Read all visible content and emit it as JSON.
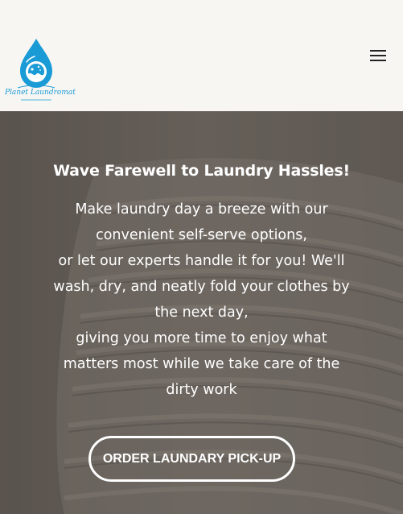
{
  "header": {
    "logo_text": "Planet Laundromat",
    "menu_icon": "hamburger-menu-icon"
  },
  "hero": {
    "title": "Wave Farewell to Laundry Hassles!",
    "body_lines": [
      "Make laundry day a breeze with our",
      "convenient self-serve options,",
      "or let our experts handle it for you! We'll",
      "wash, dry, and neatly fold your clothes by",
      "the next day,",
      "giving you more time to enjoy what",
      "matters most while we take care of the",
      "dirty work"
    ],
    "cta_label": "ORDER LAUNDARY PICK-UP"
  },
  "colors": {
    "header_bg": "#f8f6f3",
    "brand_blue": "#1a9bd6",
    "hero_overlay": "#5f5953",
    "text_on_hero": "#ffffff"
  }
}
